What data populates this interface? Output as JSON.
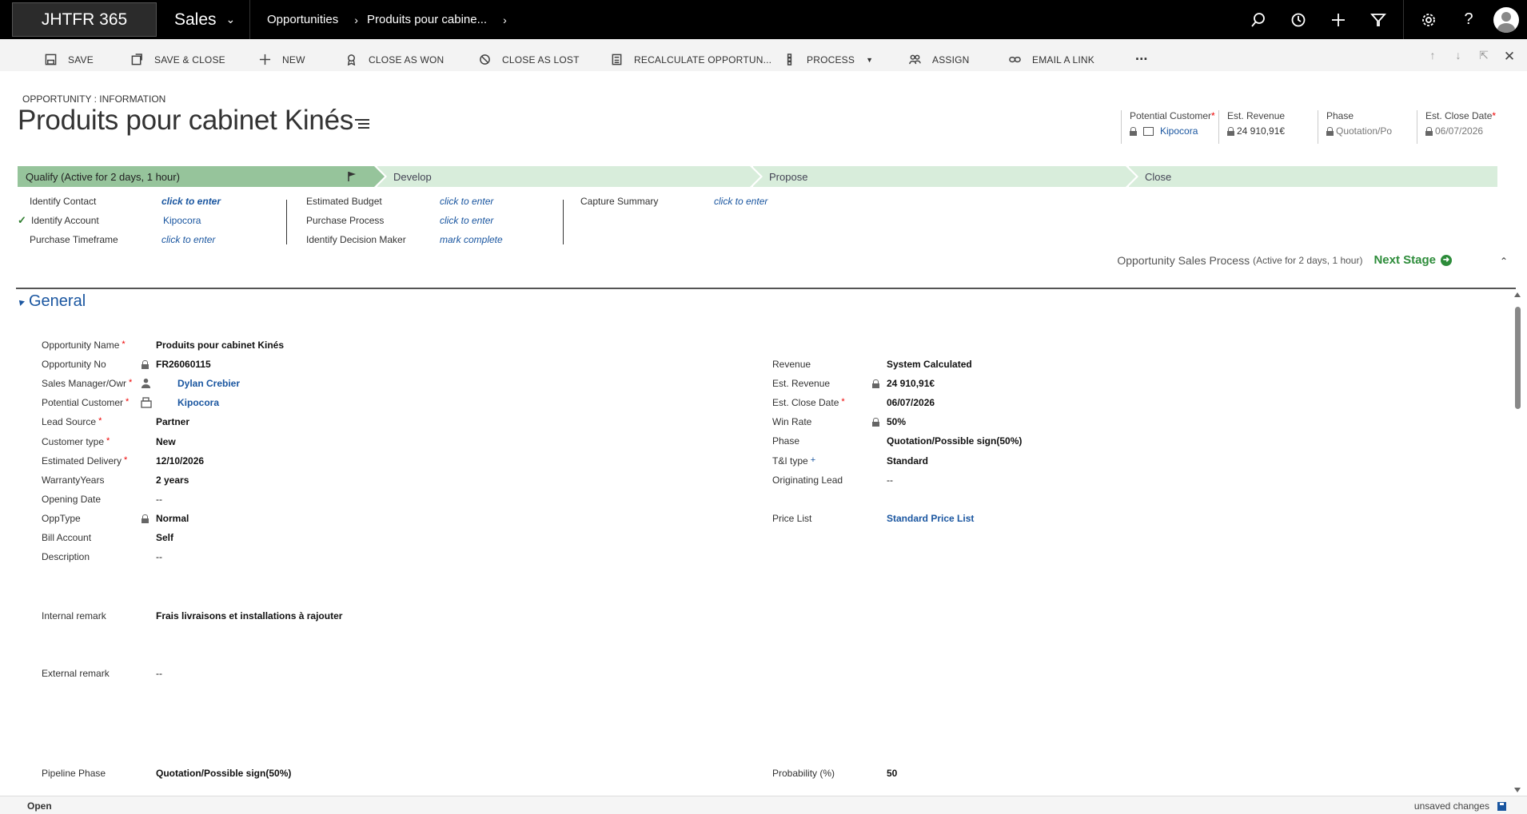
{
  "nav": {
    "brand": "JHTFR 365",
    "app": "Sales",
    "breadcrumb": [
      "Opportunities",
      "Produits pour cabine..."
    ]
  },
  "commands": [
    {
      "label": "SAVE",
      "icon": "save-icon"
    },
    {
      "label": "SAVE & CLOSE",
      "icon": "save-close-icon"
    },
    {
      "label": "NEW",
      "icon": "plus-icon"
    },
    {
      "label": "CLOSE AS WON",
      "icon": "ribbon-icon"
    },
    {
      "label": "CLOSE AS LOST",
      "icon": "ban-icon"
    },
    {
      "label": "RECALCULATE OPPORTUN...",
      "icon": "calculator-icon"
    },
    {
      "label": "PROCESS",
      "icon": "process-icon"
    },
    {
      "label": "ASSIGN",
      "icon": "assign-icon"
    },
    {
      "label": "EMAIL A LINK",
      "icon": "link-icon"
    },
    {
      "label": "...",
      "icon": "more-icon"
    }
  ],
  "header": {
    "form_type": "OPPORTUNITY : INFORMATION",
    "title": "Produits pour cabinet Kinés",
    "fields": [
      {
        "label": "Potential Customer",
        "required": "*",
        "value": "Kipocora"
      },
      {
        "label": "Est. Revenue",
        "required": "",
        "value": "24 910,91€"
      },
      {
        "label": "Phase",
        "required": "",
        "value": "Quotation/Po"
      },
      {
        "label": "Est. Close Date",
        "required": "*",
        "value": "06/07/2026"
      }
    ]
  },
  "process": {
    "stages": [
      {
        "label": "Qualify (Active for 2 days, 1 hour)",
        "active": true
      },
      {
        "label": "Develop",
        "active": false
      },
      {
        "label": "Propose",
        "active": false
      },
      {
        "label": "Close",
        "active": false
      }
    ],
    "steps_col1": [
      {
        "label": "Identify Contact",
        "value": "click to enter",
        "checked": false
      },
      {
        "label": "Identify Account",
        "value": "Kipocora",
        "checked": true
      },
      {
        "label": "Purchase Timeframe",
        "value": "click to enter",
        "checked": false
      }
    ],
    "steps_col2": [
      {
        "label": "Estimated Budget",
        "value": "click to enter"
      },
      {
        "label": "Purchase Process",
        "value": "click to enter"
      },
      {
        "label": "Identify Decision Maker",
        "value": "mark complete"
      }
    ],
    "steps_col3": [
      {
        "label": "Capture Summary",
        "value": "click to enter"
      }
    ],
    "footer_name": "Opportunity Sales Process",
    "footer_sub": "(Active for 2 days, 1 hour)",
    "next_stage": "Next Stage"
  },
  "general": {
    "title": "General",
    "left": [
      {
        "label": "Opportunity Name",
        "req": "*",
        "value": "Produits pour cabinet Kinés",
        "locked": false,
        "link": false,
        "icon": ""
      },
      {
        "label": "Opportunity No",
        "req": "",
        "value": "FR26060115",
        "locked": true,
        "link": false,
        "icon": ""
      },
      {
        "label": "Sales Manager/Owr",
        "req": "*",
        "value": "Dylan Crebier",
        "locked": false,
        "link": true,
        "icon": "user-icon"
      },
      {
        "label": "Potential Customer",
        "req": "*",
        "value": "Kipocora",
        "locked": false,
        "link": true,
        "icon": "account-icon"
      },
      {
        "label": "Lead Source",
        "req": "*",
        "value": "Partner",
        "locked": false,
        "link": false,
        "icon": ""
      },
      {
        "label": "Customer type",
        "req": "*",
        "value": "New",
        "locked": false,
        "link": false,
        "icon": ""
      },
      {
        "label": "Estimated Delivery",
        "req": "*",
        "value": "12/10/2026",
        "locked": false,
        "link": false,
        "icon": ""
      },
      {
        "label": "WarrantyYears",
        "req": "",
        "value": "2 years",
        "locked": false,
        "link": false,
        "icon": ""
      },
      {
        "label": "Opening Date",
        "req": "",
        "value": "--",
        "locked": false,
        "link": false,
        "icon": ""
      },
      {
        "label": "OppType",
        "req": "",
        "value": "Normal",
        "locked": true,
        "link": false,
        "icon": ""
      },
      {
        "label": "Bill Account",
        "req": "",
        "value": "Self",
        "locked": false,
        "link": false,
        "icon": ""
      },
      {
        "label": "Description",
        "req": "",
        "value": "--",
        "locked": false,
        "link": false,
        "icon": ""
      }
    ],
    "right": [
      {
        "label": "Revenue",
        "req": "",
        "value": "System Calculated",
        "locked": false,
        "link": false
      },
      {
        "label": "Est. Revenue",
        "req": "",
        "value": "24 910,91€",
        "locked": true,
        "link": false
      },
      {
        "label": "Est. Close Date",
        "req": "*",
        "value": "06/07/2026",
        "locked": false,
        "link": false
      },
      {
        "label": "Win Rate",
        "req": "",
        "value": "50%",
        "locked": true,
        "link": false
      },
      {
        "label": "Phase",
        "req": "",
        "value": "Quotation/Possible sign(50%)",
        "locked": false,
        "link": false
      },
      {
        "label": "T&I type",
        "req": "+",
        "value": "Standard",
        "locked": false,
        "link": false
      },
      {
        "label": "Originating Lead",
        "req": "",
        "value": "--",
        "locked": false,
        "link": false
      },
      {
        "label": "Price List",
        "req": "",
        "value": "Standard Price List",
        "locked": false,
        "link": true
      }
    ],
    "internal_remark": {
      "label": "Internal remark",
      "value": "Frais livraisons et installations à rajouter"
    },
    "external_remark": {
      "label": "External remark",
      "value": "--"
    },
    "pipeline_phase": {
      "label": "Pipeline Phase",
      "value": "Quotation/Possible sign(50%)"
    },
    "probability": {
      "label": "Probability (%)",
      "value": "50"
    }
  },
  "status": {
    "state": "Open",
    "right": "unsaved changes"
  }
}
